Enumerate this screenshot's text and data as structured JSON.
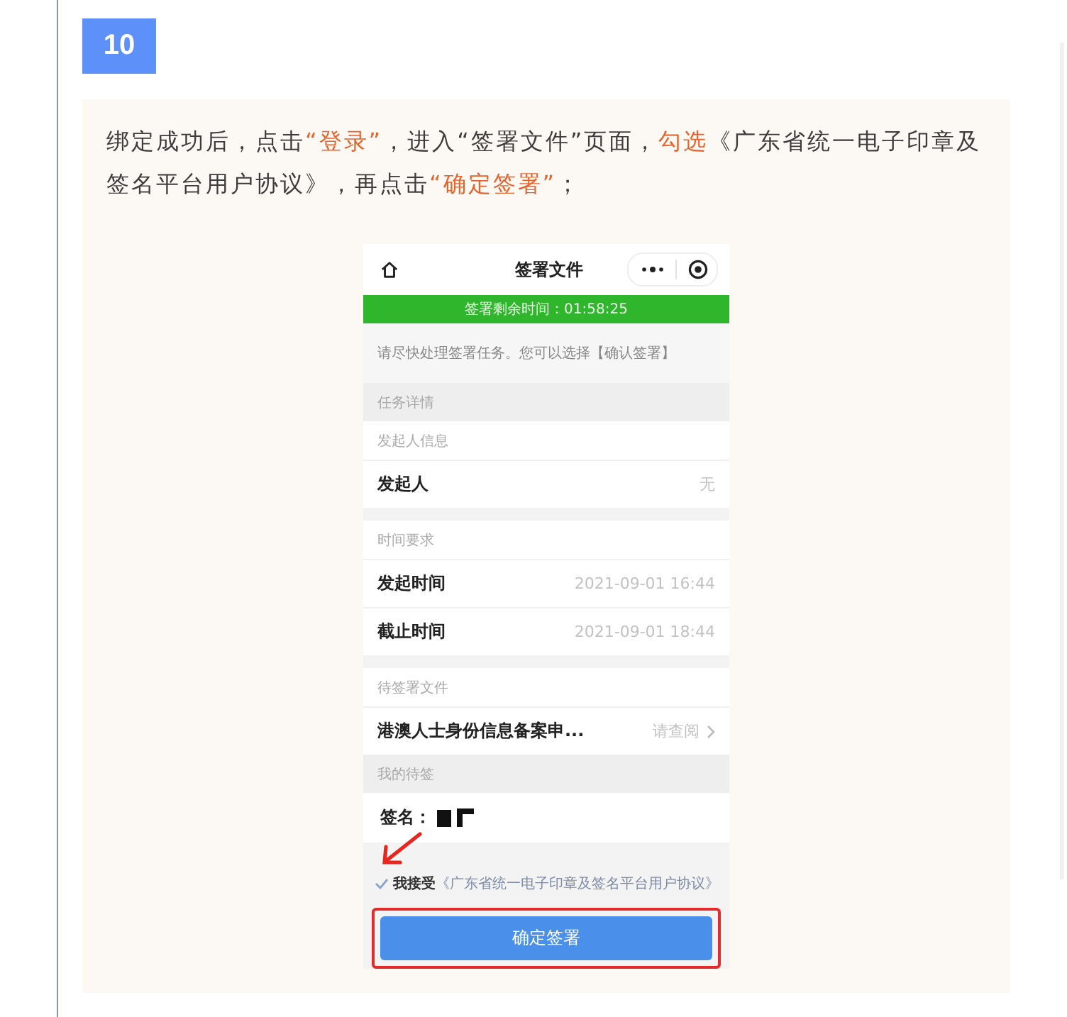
{
  "step": {
    "number": "10"
  },
  "instruction": {
    "segments": [
      {
        "text": "绑定成功后，点击",
        "highlighted": false
      },
      {
        "text": "“登录”",
        "highlighted": true
      },
      {
        "text": "，进入“签署文件”页面，",
        "highlighted": false
      },
      {
        "text": "勾选",
        "highlighted": true
      },
      {
        "text": "《广东省统一电子印章及签名平台用户协议》，再点击",
        "highlighted": false
      },
      {
        "text": "“确定签署”",
        "highlighted": true
      },
      {
        "text": "；",
        "highlighted": false
      }
    ]
  },
  "screenshot": {
    "nav_bar": {
      "title": "签署文件"
    },
    "timer_bar": {
      "text": "签署剩余时间：01:58:25"
    },
    "notice": "请尽快处理签署任务。您可以选择【确认签署】",
    "task_details": {
      "title": "任务详情",
      "groups": [
        {
          "title": "发起人信息",
          "rows": [
            {
              "kind": "info",
              "label": "发起人",
              "value": "无"
            }
          ]
        },
        {
          "title": "时间要求",
          "rows": [
            {
              "kind": "info",
              "label": "发起时间",
              "value": "2021-09-01 16:44"
            },
            {
              "kind": "info",
              "label": "截止时间",
              "value": "2021-09-01 18:44"
            }
          ]
        },
        {
          "title": "待签署文件",
          "rows": [
            {
              "kind": "link",
              "label": "港澳人士身份信息备案申...",
              "value": "请查阅"
            }
          ]
        }
      ]
    },
    "my_signing": {
      "title": "我的待签",
      "signature_label": "签名：",
      "agreement": {
        "checked": true,
        "prefix": "我接受",
        "link": "《广东省统一电子印章及签名平台用户协议》"
      },
      "confirm_button": {
        "label": "确定签署",
        "highlighted": true
      }
    }
  }
}
